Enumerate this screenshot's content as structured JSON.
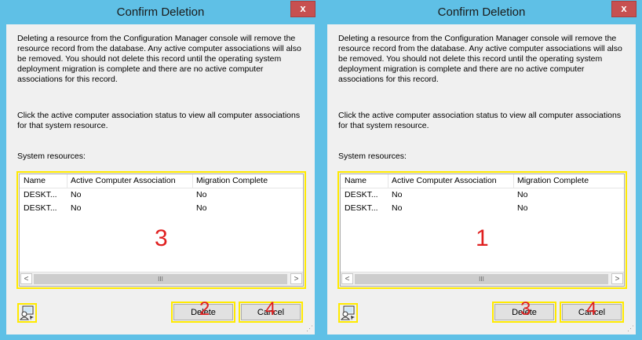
{
  "dialogs": [
    {
      "title": "Confirm Deletion",
      "close_glyph": "x",
      "paragraph1": "Deleting a resource from the Configuration Manager console will remove the resource record from the database. Any active computer associations will also be removed. You should not delete this record until the operating system deployment migration is complete and there are no active computer associations for this record.",
      "paragraph2": "Click the active computer association status to view all computer associations for that system resource.",
      "system_resources_label": "System resources:",
      "columns": [
        "Name",
        "Active Computer Association",
        "Migration Complete"
      ],
      "rows": [
        [
          "DESKT...",
          "No",
          "No"
        ],
        [
          "DESKT...",
          "No",
          "No"
        ]
      ],
      "scroll_left": "<",
      "scroll_right": ">",
      "scroll_thumb": "III",
      "annotation_list": "3",
      "delete_label": "Delete",
      "cancel_label": "Cancel",
      "annotation_delete": "2",
      "annotation_cancel": "4",
      "icon": "computer-user-icon"
    },
    {
      "title": "Confirm Deletion",
      "close_glyph": "x",
      "paragraph1": "Deleting a resource from the Configuration Manager console will remove the resource record from the database. Any active computer associations will also be removed. You should not delete this record until the operating system deployment migration is complete and there are no active computer associations for this record.",
      "paragraph2": "Click the active computer association status to view all computer associations for that system resource.",
      "system_resources_label": "System resources:",
      "columns": [
        "Name",
        "Active Computer Association",
        "Migration Complete"
      ],
      "rows": [
        [
          "DESKT...",
          "No",
          "No"
        ],
        [
          "DESKT...",
          "No",
          "No"
        ]
      ],
      "scroll_left": "<",
      "scroll_right": ">",
      "scroll_thumb": "III",
      "annotation_list": "1",
      "delete_label": "Delete",
      "cancel_label": "Cancel",
      "annotation_delete": "3",
      "annotation_cancel": "4",
      "icon": "computer-user-icon"
    }
  ],
  "colors": {
    "frame": "#5fc0e6",
    "close": "#c75050",
    "highlight": "#ffea00",
    "annotation": "#e02020"
  }
}
